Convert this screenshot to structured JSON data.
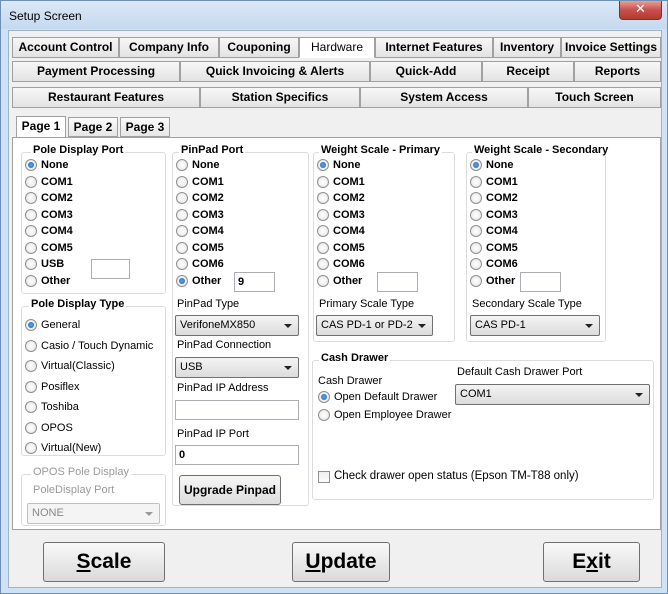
{
  "window": {
    "title": "Setup Screen",
    "close": "✕"
  },
  "tabs_row1": [
    "Account Control",
    "Company Info",
    "Couponing",
    "Hardware",
    "Internet Features",
    "Inventory",
    "Invoice Settings"
  ],
  "tabs_row2": [
    "Payment Processing",
    "Quick Invoicing & Alerts",
    "Quick-Add",
    "Receipt",
    "Reports"
  ],
  "tabs_row3": [
    "Restaurant Features",
    "Station Specifics",
    "System Access",
    "Touch Screen"
  ],
  "subtabs": [
    "Page 1",
    "Page 2",
    "Page 3"
  ],
  "pole_port": {
    "title": "Pole Display Port",
    "options": [
      "None",
      "COM1",
      "COM2",
      "COM3",
      "COM4",
      "COM5",
      "USB",
      "Other"
    ],
    "selected": "None",
    "other_value": ""
  },
  "pinpad_port": {
    "title": "PinPad Port",
    "options": [
      "None",
      "COM1",
      "COM2",
      "COM3",
      "COM4",
      "COM5",
      "COM6",
      "Other"
    ],
    "selected": "Other",
    "other_value": "9"
  },
  "scale_primary": {
    "title": "Weight Scale - Primary",
    "options": [
      "None",
      "COM1",
      "COM2",
      "COM3",
      "COM4",
      "COM5",
      "COM6",
      "Other"
    ],
    "selected": "None",
    "other_value": ""
  },
  "scale_secondary": {
    "title": "Weight Scale - Secondary",
    "options": [
      "None",
      "COM1",
      "COM2",
      "COM3",
      "COM4",
      "COM5",
      "COM6",
      "Other"
    ],
    "selected": "None",
    "other_value": ""
  },
  "pole_type": {
    "title": "Pole Display Type",
    "options": [
      "General",
      "Casio / Touch Dynamic",
      "Virtual(Classic)",
      "Posiflex",
      "Toshiba",
      "OPOS",
      "Virtual(New)"
    ],
    "selected": "General"
  },
  "opos": {
    "title": "OPOS Pole Display",
    "port_label": "PoleDisplay Port",
    "port_value": "NONE"
  },
  "pinpad": {
    "type_label": "PinPad Type",
    "type_value": "VerifoneMX850",
    "conn_label": "PinPad Connection",
    "conn_value": "USB",
    "ip_label": "PinPad IP Address",
    "ip_value": "",
    "port_label": "PinPad IP Port",
    "port_value": "0",
    "upgrade": "Upgrade Pinpad"
  },
  "primary_type": {
    "label": "Primary Scale Type",
    "value": "CAS PD-1 or PD-2"
  },
  "secondary_type": {
    "label": "Secondary Scale Type",
    "value": "CAS PD-1"
  },
  "cash_drawer": {
    "title": "Cash Drawer",
    "sub_label": "Cash Drawer",
    "options": [
      "Open Default Drawer",
      "Open Employee Drawer"
    ],
    "selected": "Open Default Drawer",
    "port_label": "Default Cash Drawer Port",
    "port_value": "COM1",
    "check_label": "Check drawer open status (Epson TM-T88 only)",
    "checked": false
  },
  "buttons": {
    "scale_hot": "S",
    "scale_rest": "cale",
    "update_hot": "U",
    "update_rest": "pdate",
    "exit_pre": "E",
    "exit_hot": "x",
    "exit_rest": "it"
  }
}
